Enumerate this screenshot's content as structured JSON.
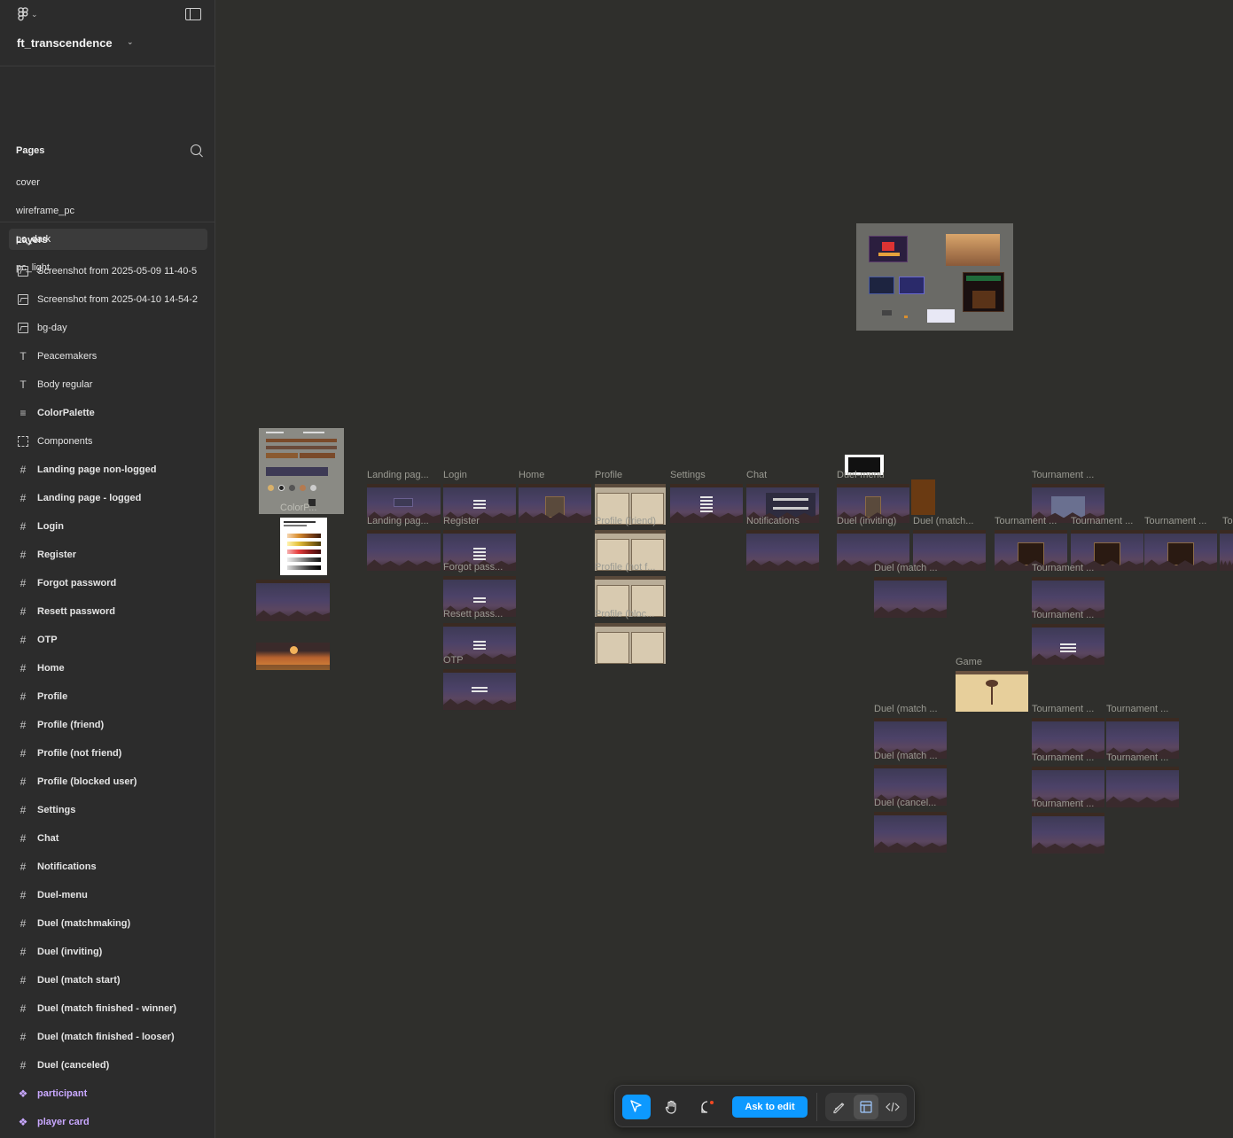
{
  "file": {
    "name": "ft_transcendence"
  },
  "pages": {
    "title": "Pages",
    "items": [
      "cover",
      "wireframe_pc",
      "pc_dark",
      "pc_light"
    ],
    "active": "pc_dark"
  },
  "layers": {
    "title": "Layers",
    "items": [
      {
        "label": "Screenshot from 2025-05-09 11-40-5",
        "icon": "image-icon"
      },
      {
        "label": "Screenshot from 2025-04-10 14-54-2",
        "icon": "image-icon"
      },
      {
        "label": "bg-day",
        "icon": "image-icon"
      },
      {
        "label": "Peacemakers",
        "icon": "text-icon"
      },
      {
        "label": "Body regular",
        "icon": "text-icon"
      },
      {
        "label": "ColorPalette",
        "icon": "autolayout-icon"
      },
      {
        "label": "Components",
        "icon": "section-icon"
      },
      {
        "label": "Landing page non-logged",
        "icon": "frame-icon"
      },
      {
        "label": "Landing page - logged",
        "icon": "frame-icon"
      },
      {
        "label": "Login",
        "icon": "frame-icon"
      },
      {
        "label": "Register",
        "icon": "frame-icon"
      },
      {
        "label": "Forgot password",
        "icon": "frame-icon"
      },
      {
        "label": "Resett password",
        "icon": "frame-icon"
      },
      {
        "label": "OTP",
        "icon": "frame-icon"
      },
      {
        "label": "Home",
        "icon": "frame-icon"
      },
      {
        "label": "Profile",
        "icon": "frame-icon"
      },
      {
        "label": "Profile (friend)",
        "icon": "frame-icon"
      },
      {
        "label": "Profile (not friend)",
        "icon": "frame-icon"
      },
      {
        "label": "Profile (blocked user)",
        "icon": "frame-icon"
      },
      {
        "label": "Settings",
        "icon": "frame-icon"
      },
      {
        "label": "Chat",
        "icon": "frame-icon"
      },
      {
        "label": "Notifications",
        "icon": "frame-icon"
      },
      {
        "label": "Duel-menu",
        "icon": "frame-icon"
      },
      {
        "label": "Duel (matchmaking)",
        "icon": "frame-icon"
      },
      {
        "label": "Duel (inviting)",
        "icon": "frame-icon"
      },
      {
        "label": "Duel (match start)",
        "icon": "frame-icon"
      },
      {
        "label": "Duel (match finished - winner)",
        "icon": "frame-icon"
      },
      {
        "label": "Duel (match finished - looser)",
        "icon": "frame-icon"
      },
      {
        "label": "Duel (canceled)",
        "icon": "frame-icon"
      },
      {
        "label": "participant",
        "icon": "component-icon"
      },
      {
        "label": "player card",
        "icon": "component-icon"
      }
    ]
  },
  "canvas": {
    "labels": {
      "colorp": "ColorP...",
      "landing1": "Landing pag...",
      "landing2": "Landing pag...",
      "login": "Login",
      "register": "Register",
      "forgot": "Forgot pass...",
      "resett": "Resett pass...",
      "otp": "OTP",
      "home": "Home",
      "profile": "Profile",
      "profile_friend": "Profile (friend)",
      "profile_not": "Profile (not f...",
      "profile_block": "Profile (bloc...",
      "settings": "Settings",
      "chat": "Chat",
      "notifications": "Notifications",
      "duel_menu": "Duel-menu",
      "duel_inviting": "Duel (inviting)",
      "duel_match": "Duel (match...",
      "duel_match2": "Duel (match ...",
      "duel_match3": "Duel (match ...",
      "duel_match4": "Duel (match ...",
      "duel_cancel": "Duel (cancel...",
      "game": "Game",
      "tournament": "Tournament ...",
      "tournament_short": "To"
    }
  },
  "toolbar": {
    "ask_label": "Ask to edit",
    "tools": [
      "move-tool",
      "hand-tool",
      "comment-tool"
    ],
    "modes": [
      "draw-mode",
      "design-mode",
      "dev-mode"
    ],
    "accent": "#0d99ff"
  }
}
